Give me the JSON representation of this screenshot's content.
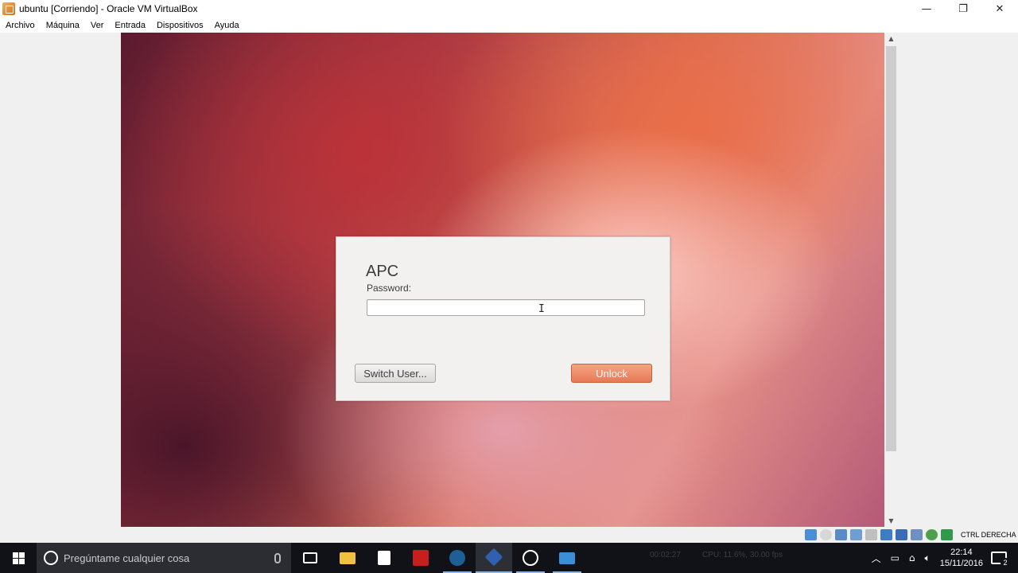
{
  "window": {
    "title": "ubuntu [Corriendo] - Oracle VM VirtualBox",
    "controls": {
      "minimize": "—",
      "restore": "❐",
      "close": "✕"
    }
  },
  "menubar": {
    "items": [
      "Archivo",
      "Máquina",
      "Ver",
      "Entrada",
      "Dispositivos",
      "Ayuda"
    ]
  },
  "vm": {
    "lock_dialog": {
      "username": "APC",
      "password_label": "Password:",
      "password_value": "",
      "switch_user_label": "Switch User...",
      "unlock_label": "Unlock"
    }
  },
  "statusbar": {
    "host_key_text": "CTRL DERECHA",
    "icons": [
      "hard-disk-icon",
      "optical-drive-icon",
      "audio-icon",
      "network-icon",
      "usb-icon",
      "shared-folders-icon",
      "display-icon",
      "video-capture-icon",
      "cpu-icon",
      "mouse-integration-icon"
    ]
  },
  "taskbar": {
    "search_placeholder": "Pregúntame cualquier cosa",
    "overlay_time": "00:02:27",
    "overlay_stats": "CPU: 11.6%, 30.00 fps",
    "apps": [
      {
        "name": "task-view-icon",
        "color": "#ffffff"
      },
      {
        "name": "file-explorer-icon",
        "color": "#f0c040"
      },
      {
        "name": "store-icon",
        "color": "#ffffff"
      },
      {
        "name": "red-app-icon",
        "color": "#d02020"
      },
      {
        "name": "steam-icon",
        "color": "#2a6ea8"
      },
      {
        "name": "virtualbox-icon",
        "color": "#3060b0"
      },
      {
        "name": "obs-icon",
        "color": "#ffffff"
      },
      {
        "name": "remote-desktop-icon",
        "color": "#3c8ed8"
      }
    ],
    "clock_time": "22:14",
    "clock_date": "15/11/2016",
    "notification_count": "2"
  },
  "colors": {
    "unlock_button": "#e67a55",
    "taskbar_bg": "#101217",
    "wallpaper_primary": "#c8463e"
  }
}
